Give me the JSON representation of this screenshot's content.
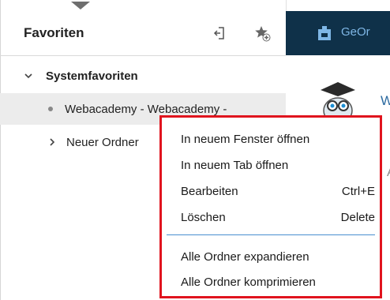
{
  "favorites_panel": {
    "title": "Favoriten",
    "tree": [
      {
        "label": "Systemfavoriten",
        "expanded": true
      },
      {
        "label": "Webacademy - Webacademy -",
        "selected": true
      },
      {
        "label": "Neuer Ordner",
        "expanded": false
      }
    ]
  },
  "app": {
    "header_text": "GeOr",
    "body_text_w": "W",
    "body_text_a": "A"
  },
  "context_menu": {
    "items": [
      {
        "label": "In neuem Fenster öffnen",
        "shortcut": ""
      },
      {
        "label": "In neuem Tab öffnen",
        "shortcut": ""
      },
      {
        "label": "Bearbeiten",
        "shortcut": "Ctrl+E"
      },
      {
        "label": "Löschen",
        "shortcut": "Delete"
      },
      {
        "label": "Alle Ordner expandieren",
        "shortcut": ""
      },
      {
        "label": "Alle Ordner komprimieren",
        "shortcut": ""
      }
    ]
  },
  "colors": {
    "app_header_bg": "#0f3149",
    "menu_border": "#e0141e",
    "separator": "#4a8fd0",
    "selected_row": "#ececec"
  }
}
